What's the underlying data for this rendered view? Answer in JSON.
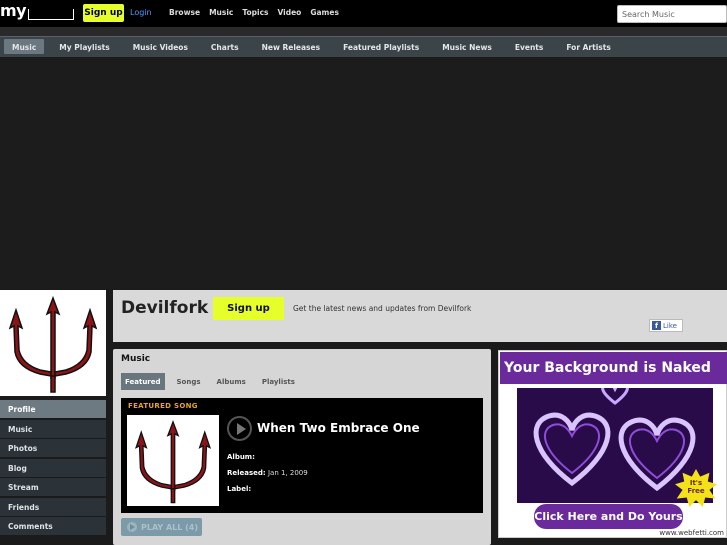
{
  "topbar": {
    "logo": "my",
    "signup": "Sign up",
    "login": "Login",
    "nav": [
      "Browse",
      "Music",
      "Topics",
      "Video",
      "Games"
    ],
    "search_placeholder": "Search Music"
  },
  "subnav": {
    "items": [
      "Music",
      "My Playlists",
      "Music Videos",
      "Charts",
      "New Releases",
      "Featured Playlists",
      "Music News",
      "Events",
      "For Artists"
    ],
    "active": "Music"
  },
  "sidenav": {
    "items": [
      "Profile",
      "Music",
      "Photos",
      "Blog",
      "Stream",
      "Friends",
      "Comments"
    ],
    "active": "Profile"
  },
  "header": {
    "artist": "Devilfork",
    "signup": "Sign up",
    "tagline": "Get the latest news and updates from Devilfork",
    "like": "Like"
  },
  "music": {
    "title": "Music",
    "tabs": [
      "Featured",
      "Songs",
      "Albums",
      "Playlists"
    ],
    "active_tab": "Featured",
    "featured_label": "FEATURED SONG",
    "song_title": "When Two Embrace One",
    "album_label": "Album:",
    "album_value": "",
    "released_label": "Released:",
    "released_value": "Jan 1, 2009",
    "label_label": "Label:",
    "label_value": "",
    "play_all": "PLAY ALL (4)"
  },
  "ad": {
    "headline": "Your Background is Naked",
    "badge_line1": "It's",
    "badge_line2": "Free",
    "cta": "Click Here and Do Yours",
    "url": "www.webfetti.com"
  },
  "colors": {
    "accent_yellow": "#e6ff2b",
    "nav_bg": "#3b4449",
    "featured_orange": "#e8a323",
    "ad_purple": "#6a2a9c"
  }
}
